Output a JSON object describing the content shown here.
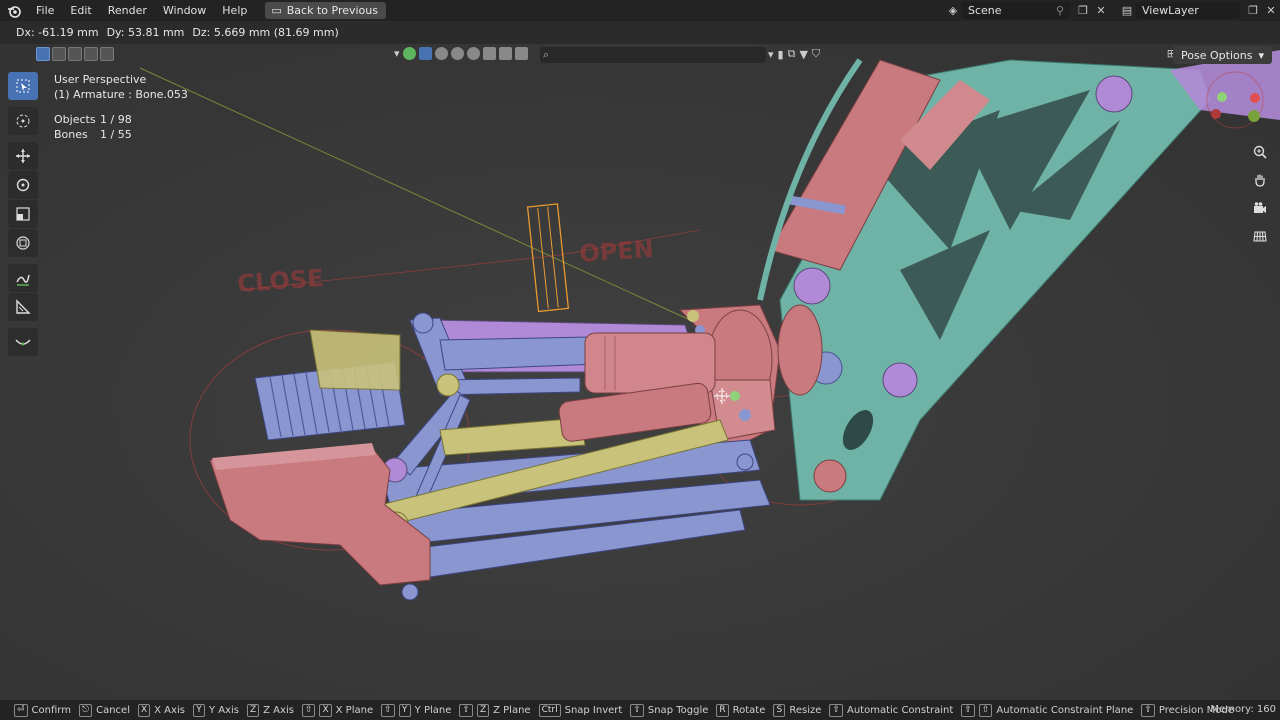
{
  "menu": {
    "items": [
      "File",
      "Edit",
      "Render",
      "Window",
      "Help"
    ],
    "back_button": "Back to Previous"
  },
  "topright": {
    "scene_label": "Scene",
    "viewlayer_label": "ViewLayer"
  },
  "transform": {
    "dx": "Dx: -61.19 mm",
    "dy": "Dy: 53.81 mm",
    "dz": "Dz: 5.669 mm (81.69 mm)"
  },
  "viewport": {
    "perspective": "User Perspective",
    "active": "(1) Armature : Bone.053",
    "objects_label": "Objects",
    "objects_value": "1 / 98",
    "bones_label": "Bones",
    "bones_value": "1 / 55",
    "pose_options": "Pose Options",
    "label_close": "CLOSE",
    "label_open": "OPEN"
  },
  "status": {
    "hints": [
      {
        "keys": [
          "⏎"
        ],
        "label": "Confirm"
      },
      {
        "keys": [
          "⎋"
        ],
        "label": "Cancel"
      },
      {
        "keys": [
          "X"
        ],
        "label": "X Axis"
      },
      {
        "keys": [
          "Y"
        ],
        "label": "Y Axis"
      },
      {
        "keys": [
          "Z"
        ],
        "label": "Z Axis"
      },
      {
        "keys": [
          "⇧",
          "X"
        ],
        "label": "X Plane"
      },
      {
        "keys": [
          "⇧",
          "Y"
        ],
        "label": "Y Plane"
      },
      {
        "keys": [
          "⇧",
          "Z"
        ],
        "label": "Z Plane"
      },
      {
        "keys": [
          "Ctrl"
        ],
        "label": "Snap Invert"
      },
      {
        "keys": [
          "⇧"
        ],
        "label": "Snap Toggle"
      },
      {
        "keys": [
          "R"
        ],
        "label": "Rotate"
      },
      {
        "keys": [
          "S"
        ],
        "label": "Resize"
      },
      {
        "keys": [
          "⇧"
        ],
        "label": "Automatic Constraint"
      },
      {
        "keys": [
          "⇧",
          "⇧"
        ],
        "label": "Automatic Constraint Plane"
      },
      {
        "keys": [
          "⇧"
        ],
        "label": "Precision Mode"
      }
    ],
    "memory": "Memory: 160"
  },
  "colors": {
    "accent": "#4772b3",
    "teal": "#6fb3a6",
    "pink": "#c87a7e",
    "lavender": "#8a96d0",
    "olive": "#c9c27a",
    "purple": "#b08ad6"
  }
}
